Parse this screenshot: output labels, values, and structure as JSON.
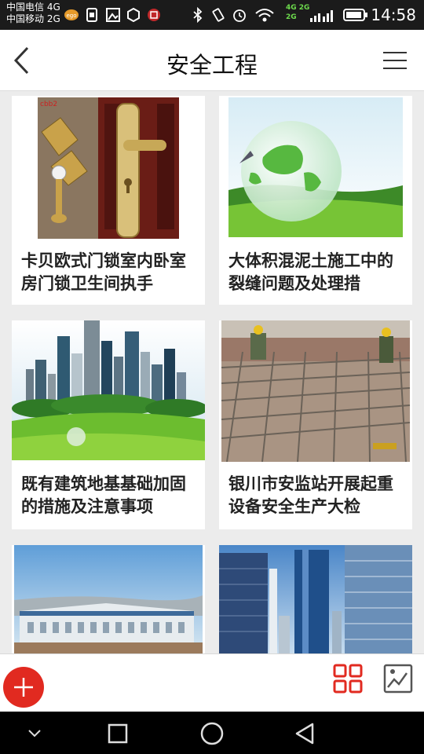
{
  "status_bar": {
    "carrier1": "中国电信 4G",
    "carrier2": "中国移动 2G",
    "net_top": "4G",
    "net_bottom": "2G",
    "net_top2": "2G",
    "time": "14:58"
  },
  "header": {
    "title": "安全工程"
  },
  "cards": [
    {
      "title": "卡贝欧式门锁室内卧室房门锁卫生间执手"
    },
    {
      "title": "大体积混泥土施工中的裂缝问题及处理措"
    },
    {
      "title": "既有建筑地基基础加固的措施及注意事项"
    },
    {
      "title": "银川市安监站开展起重设备安全生产大检"
    },
    {
      "title": ""
    },
    {
      "title": ""
    }
  ],
  "colors": {
    "accent": "#e12a20",
    "status_bg": "#1b1b1b"
  },
  "icons": {
    "back": "chevron-left-icon",
    "menu": "hamburger-icon",
    "add": "plus-icon",
    "grid": "grid-icon",
    "photo": "image-icon"
  }
}
